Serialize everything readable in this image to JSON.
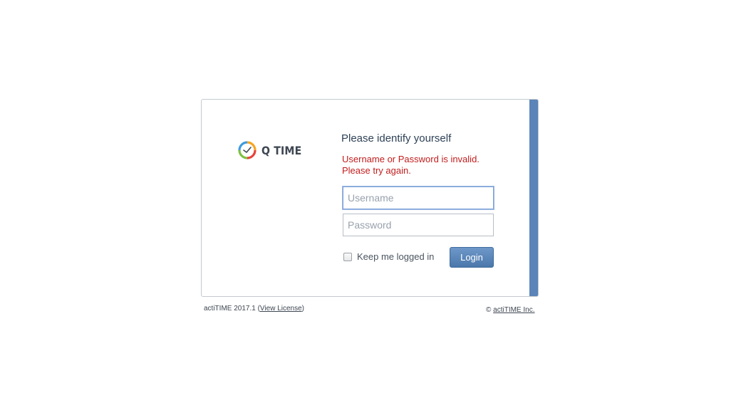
{
  "brand": {
    "name": "Q TIME",
    "logo_icon": "clock-icon",
    "colors": {
      "accent_bar": "#5b84b8",
      "error": "#c21d1d",
      "button": "#5a84b8"
    }
  },
  "form": {
    "title": "Please identify yourself",
    "error_line1": "Username or Password is invalid.",
    "error_line2": "Please try again.",
    "username_placeholder": "Username",
    "username_value": "",
    "password_placeholder": "Password",
    "password_value": "",
    "keep_logged_in_label": "Keep me logged in",
    "keep_logged_in_checked": false,
    "login_label": "Login"
  },
  "footer": {
    "version_prefix": "actiTIME 2017.1 (",
    "view_license_label": "View License",
    "version_suffix": ")",
    "copyright_symbol": "©",
    "company_link": "actiTIME Inc."
  }
}
